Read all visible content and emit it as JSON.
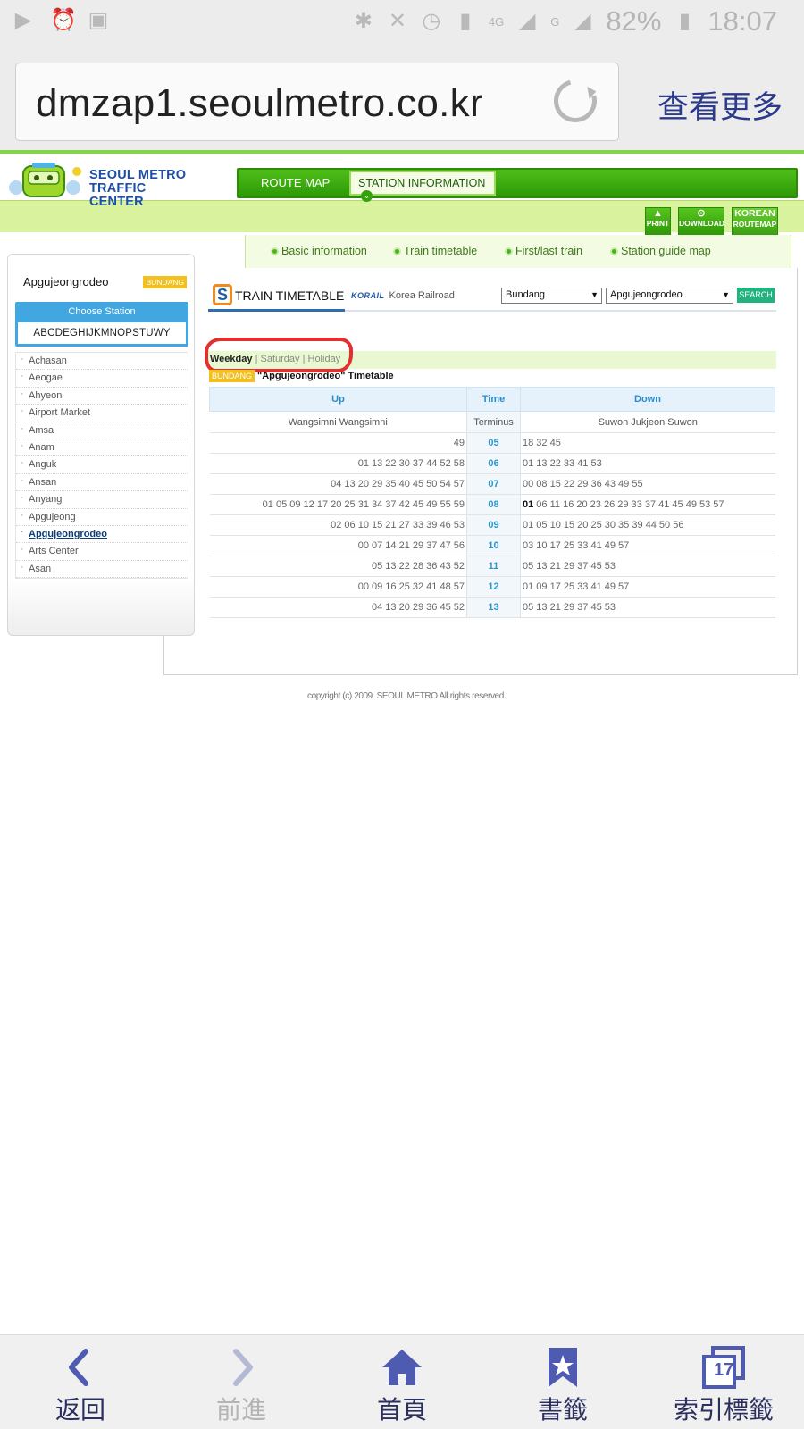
{
  "status_bar": {
    "battery": "82%",
    "time": "18:07",
    "network": "4G",
    "network2": "G"
  },
  "browser": {
    "url": "dmzap1.seoulmetro.co.kr",
    "more_label": "查看更多"
  },
  "site": {
    "logo_line1": "SEOUL METRO",
    "logo_line2": "TRAFFIC CENTER",
    "nav": [
      "ROUTE MAP",
      "STATION INFORMATION"
    ],
    "buttons": [
      "PRINT",
      "DOWNLOAD",
      "KOREAN",
      "ROUTEMAP"
    ],
    "subtabs": [
      "Basic information",
      "Train timetable",
      "First/last train",
      "Station guide map"
    ]
  },
  "sidebar": {
    "station_name": "Apgujeongrodeo",
    "line_badge": "BUNDANG",
    "choose_title": "Choose Station",
    "letters": "ABCDEGHIJKMNOPSTUWY",
    "stations": [
      "Achasan",
      "Aeogae",
      "Ahyeon",
      "Airport Market",
      "Amsa",
      "Anam",
      "Anguk",
      "Ansan",
      "Anyang",
      "Apgujeong",
      "Apgujeongrodeo",
      "Arts Center",
      "Asan"
    ],
    "active_station": "Apgujeongrodeo"
  },
  "timetable": {
    "title": "TRAIN TIMETABLE",
    "korail_logo": "KORAIL",
    "korail_text": "Korea Railroad",
    "line_select": "Bundang",
    "station_select": "Apgujeongrodeo",
    "search_label": "SEARCH",
    "days": [
      "Weekday",
      "Saturday",
      "Holiday"
    ],
    "caption_badge": "BUNDANG",
    "caption": "\"Apgujeongrodeo\" Timetable",
    "col_up": "Up",
    "col_time": "Time",
    "col_down": "Down",
    "terminus_up": "Wangsimni Wangsimni",
    "terminus_label": "Terminus",
    "terminus_down": "Suwon Jukjeon Suwon",
    "rows": [
      {
        "up": "49",
        "hour": "05",
        "down": "18 32 45",
        "down_lead": ""
      },
      {
        "up": "01 13 22 30 37 44 52 58",
        "hour": "06",
        "down": "01 13 22 33 41 53",
        "down_lead": ""
      },
      {
        "up": "04 13 20 29 35 40 45 50 54 57",
        "hour": "07",
        "down": "00 08 15 22 29 36 43 49 55",
        "down_lead": ""
      },
      {
        "up": "01 05 09 12 17 20 25 31 34 37 42 45 49 55 59",
        "hour": "08",
        "down": " 06 11 16 20 23 26 29 33 37 41 45 49 53 57",
        "down_lead": "01"
      },
      {
        "up": "02 06 10 15 21 27 33 39 46 53",
        "hour": "09",
        "down": "01 05 10 15 20 25 30 35 39 44 50 56",
        "down_lead": ""
      },
      {
        "up": "00 07 14 21 29 37 47 56",
        "hour": "10",
        "down": "03 10 17 25 33 41 49 57",
        "down_lead": ""
      },
      {
        "up": "05 13 22 28 36 43 52",
        "hour": "11",
        "down": "05 13 21 29 37 45 53",
        "down_lead": ""
      },
      {
        "up": "00 09 16 25 32 41 48 57",
        "hour": "12",
        "down": "01 09 17 25 33 41 49 57",
        "down_lead": ""
      },
      {
        "up": "04 13 20 29 36 45 52",
        "hour": "13",
        "down": "05 13 21 29 37 45 53",
        "down_lead": ""
      }
    ]
  },
  "copyright": "copyright (c) 2009. SEOUL METRO All rights reserved.",
  "bottom_nav": [
    {
      "label": "返回",
      "icon": "back-icon"
    },
    {
      "label": "前進",
      "icon": "forward-icon"
    },
    {
      "label": "首頁",
      "icon": "home-icon"
    },
    {
      "label": "書籤",
      "icon": "bookmark-icon"
    },
    {
      "label": "索引標籤",
      "icon": "tabs-icon",
      "count": "17"
    }
  ]
}
